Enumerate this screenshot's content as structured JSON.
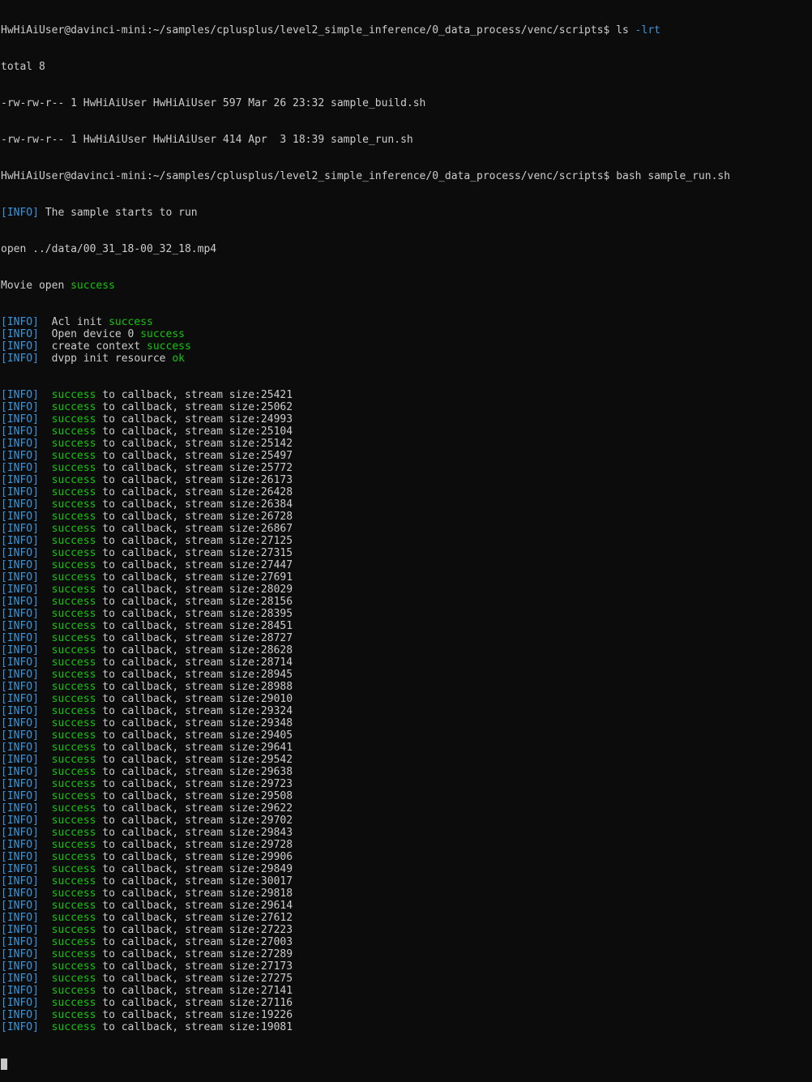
{
  "colors": {
    "background": "#0c0c0c",
    "foreground": "#cccccc",
    "info_tag": "#3a96dd",
    "success": "#16c60c",
    "cursor": "#c8c8c8"
  },
  "prompt": "HwHiAiUser@davinci-mini:~/samples/cplusplus/level2_simple_inference/0_data_process/venc/scripts$",
  "cmd1": {
    "command": "ls",
    "option": "-lrt"
  },
  "ls_output": {
    "total": "total 8",
    "files": [
      "-rw-rw-r-- 1 HwHiAiUser HwHiAiUser 597 Mar 26 23:32 sample_build.sh",
      "-rw-rw-r-- 1 HwHiAiUser HwHiAiUser 414 Apr  3 18:39 sample_run.sh"
    ]
  },
  "cmd2": {
    "command": "bash sample_run.sh"
  },
  "info_tag": "[INFO]",
  "sample_start": "The sample starts to run",
  "open_line": "open ../data/00_31_18-00_32_18.mp4",
  "movie_open": {
    "prefix": "Movie open ",
    "status": "success"
  },
  "init_lines": [
    {
      "prefix": "Acl init ",
      "status": "success"
    },
    {
      "prefix": "Open device 0 ",
      "status": "success"
    },
    {
      "prefix": "create context ",
      "status": "success"
    },
    {
      "prefix": "dvpp init resource ",
      "status": "ok"
    }
  ],
  "callback": {
    "word": "success",
    "text": " to callback, stream size:",
    "sizes": [
      "25421",
      "25062",
      "24993",
      "25104",
      "25142",
      "25497",
      "25772",
      "26173",
      "26428",
      "26384",
      "26728",
      "26867",
      "27125",
      "27315",
      "27447",
      "27691",
      "28029",
      "28156",
      "28395",
      "28451",
      "28727",
      "28628",
      "28714",
      "28945",
      "28988",
      "29010",
      "29324",
      "29348",
      "29405",
      "29641",
      "29542",
      "29638",
      "29723",
      "29508",
      "29622",
      "29702",
      "29843",
      "29728",
      "29906",
      "29849",
      "30017",
      "29818",
      "29614",
      "27612",
      "27223",
      "27003",
      "27289",
      "27173",
      "27275",
      "27141",
      "27116",
      "19226",
      "19081"
    ]
  }
}
